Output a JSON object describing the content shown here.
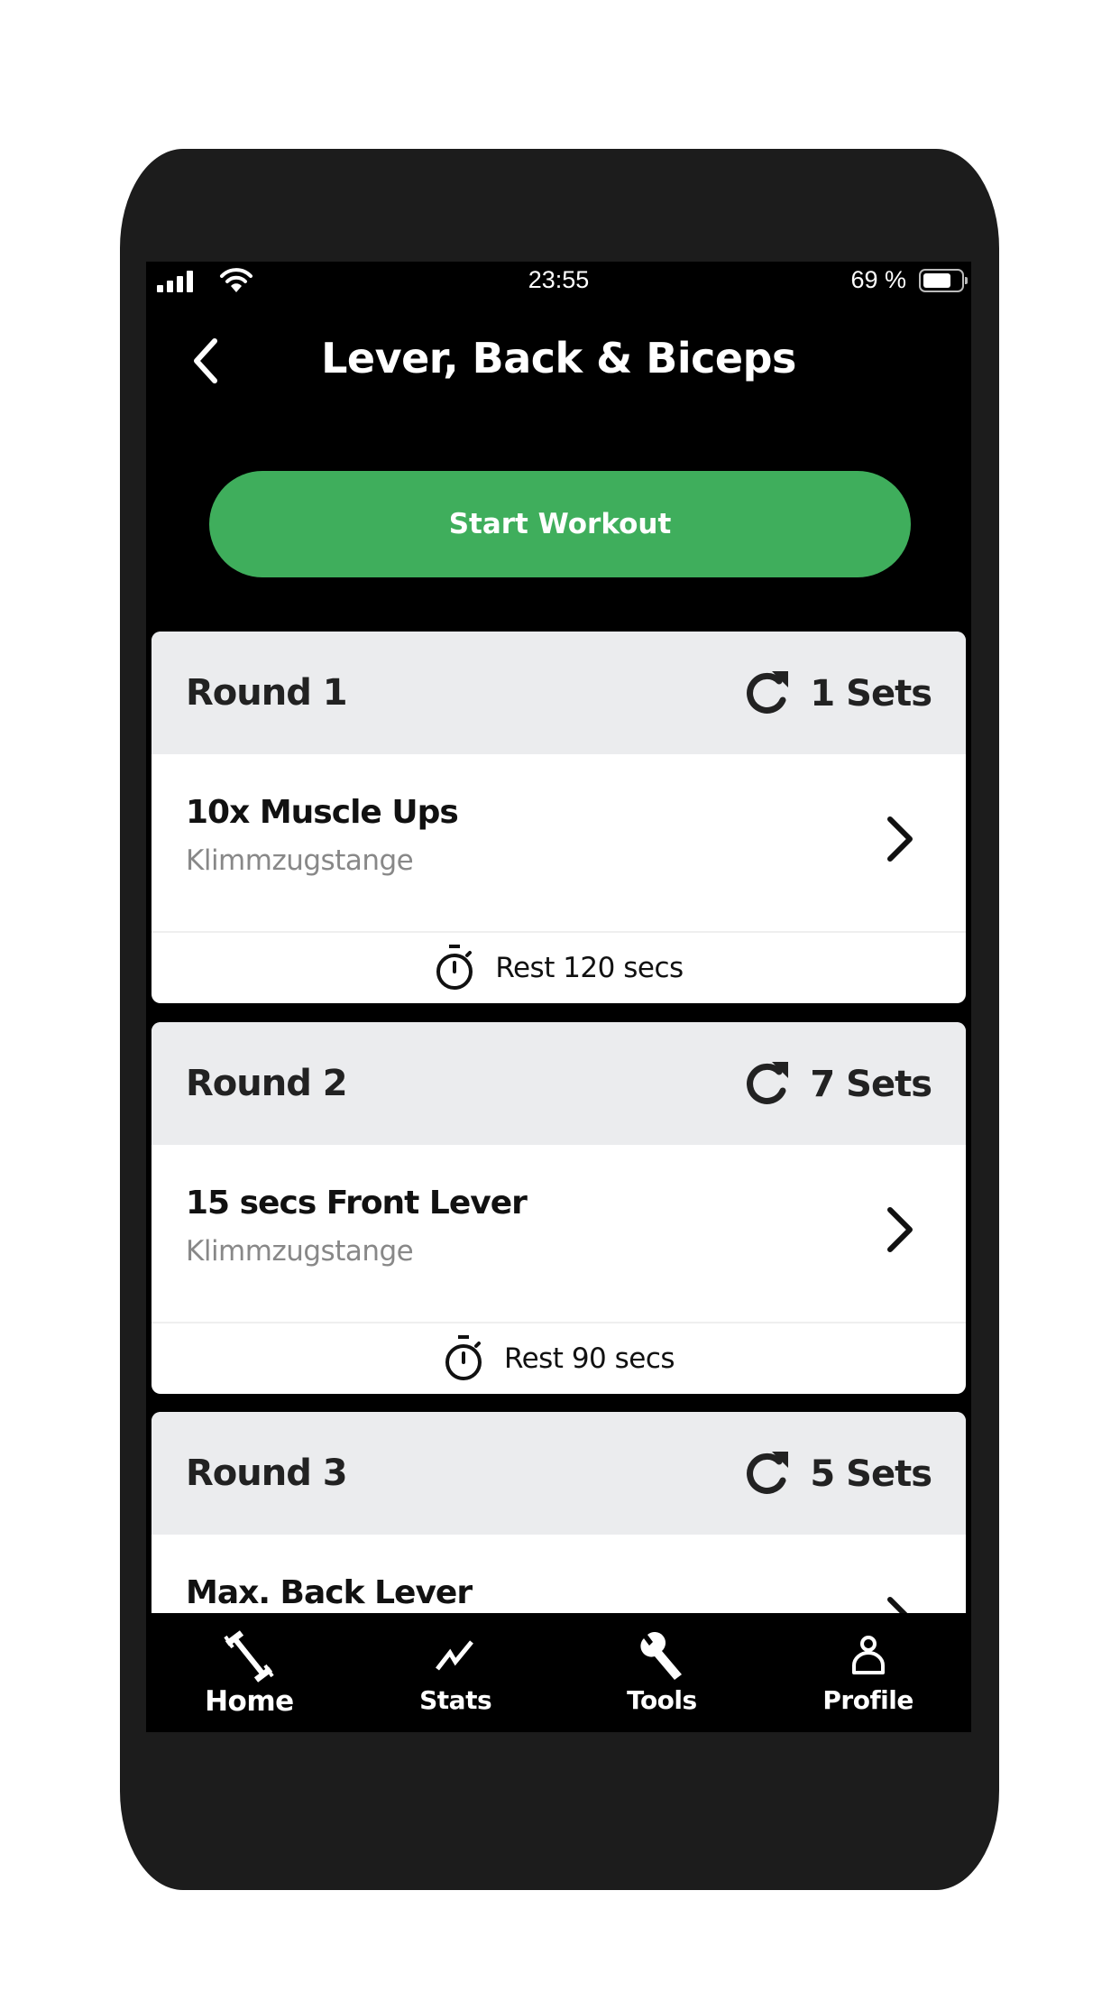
{
  "status_bar": {
    "time": "23:55",
    "battery_percent": "69 %",
    "battery_level": 0.69,
    "icons": [
      "cellular-signal-icon",
      "wifi-icon",
      "battery-icon"
    ]
  },
  "header": {
    "title": "Lever, Back & Biceps",
    "back_icon": "chevron-left-icon"
  },
  "start_button": {
    "label": "Start Workout",
    "color": "#3fae5c"
  },
  "rounds": [
    {
      "title": "Round 1",
      "sets": "1 Sets",
      "exercise": {
        "name": "10x Muscle Ups",
        "equipment": "Klimmzugstange"
      },
      "rest": "Rest 120 secs"
    },
    {
      "title": "Round 2",
      "sets": "7 Sets",
      "exercise": {
        "name": "15 secs Front Lever",
        "equipment": "Klimmzugstange"
      },
      "rest": "Rest 90 secs"
    },
    {
      "title": "Round 3",
      "sets": "5 Sets",
      "exercise": {
        "name": "Max. Back Lever",
        "equipment": ""
      }
    }
  ],
  "bottom_nav": {
    "items": [
      {
        "label": "Home",
        "icon": "dumbbell-icon",
        "active": true
      },
      {
        "label": "Stats",
        "icon": "chart-line-icon",
        "active": false
      },
      {
        "label": "Tools",
        "icon": "wrench-icon",
        "active": false
      },
      {
        "label": "Profile",
        "icon": "user-icon",
        "active": false
      }
    ]
  },
  "colors": {
    "accent_green": "#3fae5c",
    "round_header_bg": "#ebecee",
    "screen_bg": "#000000",
    "device_frame": "#1c1c1c",
    "secondary_text": "#888888"
  }
}
